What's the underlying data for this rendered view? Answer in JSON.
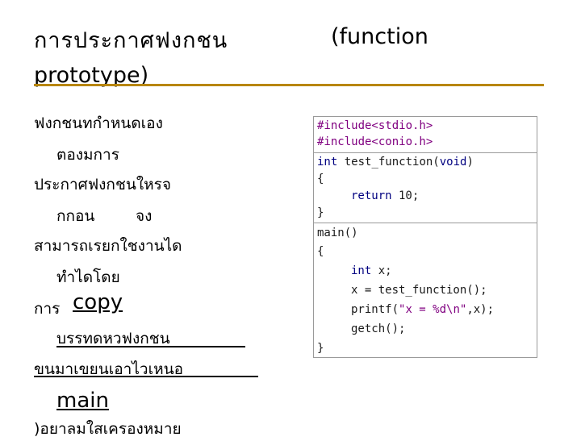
{
  "title": {
    "line1": "การประกาศฟงกชน",
    "right": "(function",
    "line2": "prototype)"
  },
  "body": {
    "l1": "ฟงกชนทกำหนดเอง",
    "l2": "ตองมการ",
    "l3": "ประกาศฟงกชนใหรจ",
    "l4a": "กกอน",
    "l4b": "จง",
    "l5": "สามารถเรยกใชงานได",
    "l6": "ทำไดโดย",
    "l7a": "การ",
    "l7b": "copy",
    "l8": "บรรทดหวฟงกชน",
    "l9": "ขนมาเขยนเอาไวเหนอ",
    "l10": "main",
    "l11": ")อยาลมใสเครองหมาย"
  },
  "code": {
    "includes": [
      "#include<stdio.h>",
      "#include<conio.h>"
    ],
    "func_sig_kw": "int",
    "func_sig_name": " test_function(",
    "func_sig_void": "void",
    "func_sig_close": ")",
    "open_brace": "{",
    "return_kw": "return",
    "return_val": " 10;",
    "close_brace": "}",
    "main_sig": "main()",
    "main_open": "{",
    "decl_kw": "int",
    "decl_rest": " x;",
    "assign": "x = test_function();",
    "printf_pre": "printf(",
    "printf_str": "\"x = %d\\n\"",
    "printf_post": ",x);",
    "getch": "getch();",
    "main_close": "}"
  }
}
